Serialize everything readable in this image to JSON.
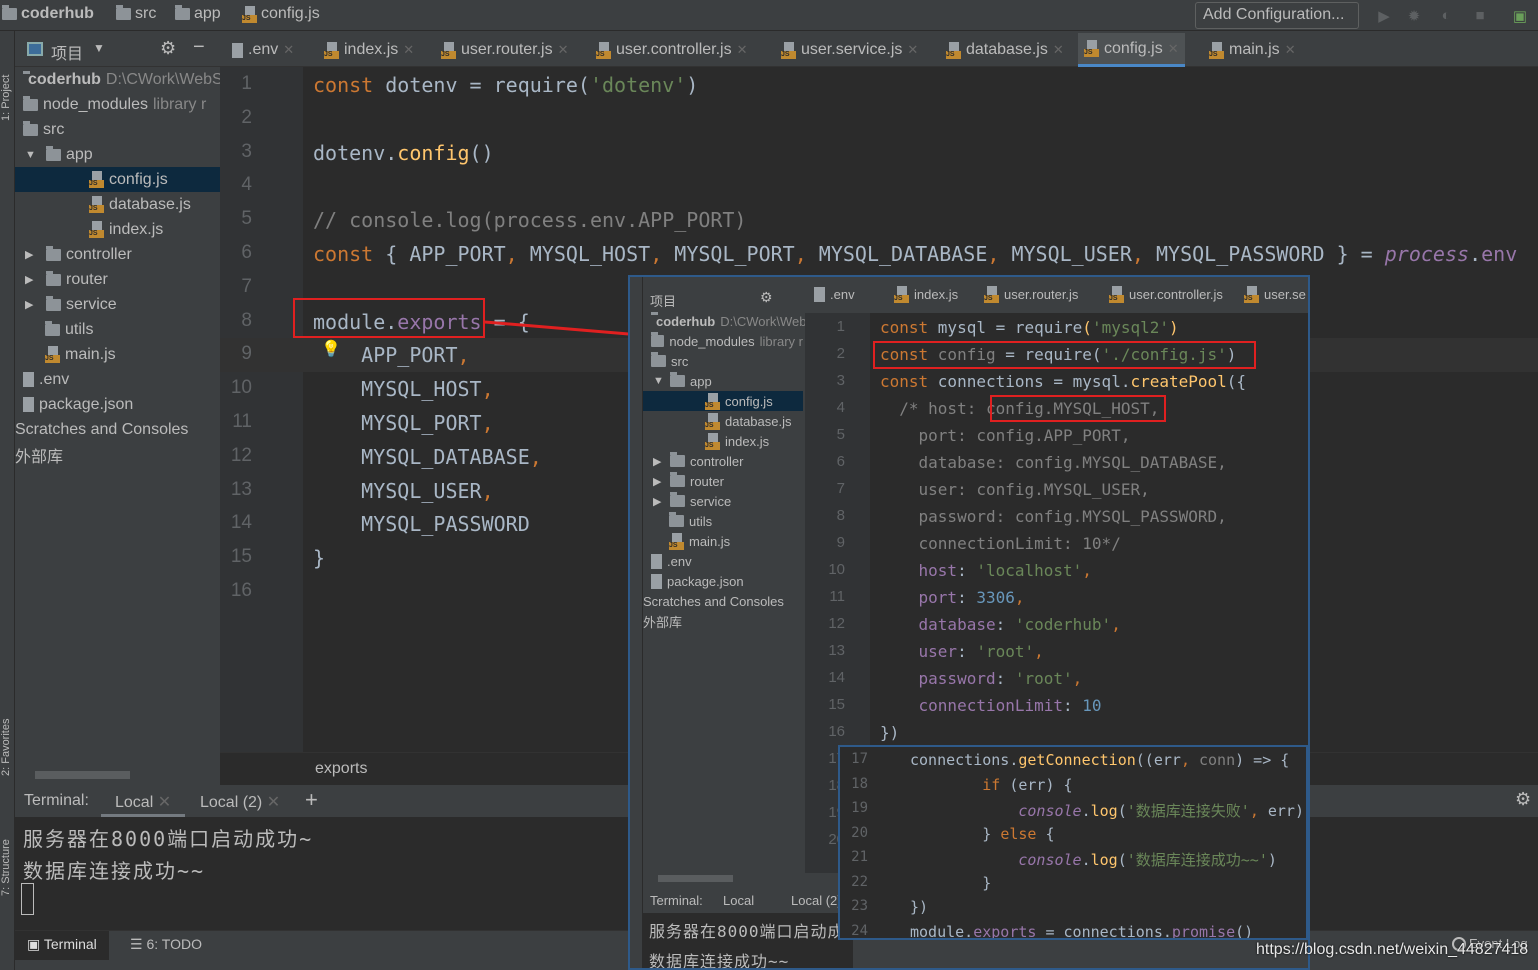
{
  "breadcrumb": [
    "coderhub",
    "src",
    "app",
    "config.js"
  ],
  "toolbar": {
    "add_configuration": "Add Configuration..."
  },
  "side_labels": {
    "project": "1: Project",
    "favorites": "2: Favorites",
    "structure": "7: Structure"
  },
  "project_panel": {
    "title": "项目"
  },
  "tabs": [
    ".env",
    "index.js",
    "user.router.js",
    "user.controller.js",
    "user.service.js",
    "database.js",
    "config.js",
    "main.js"
  ],
  "active_tab": "config.js",
  "tree": [
    {
      "label": "coderhub",
      "hint": "D:\\CWork\\WebS",
      "icon": "folder",
      "indent": 0,
      "bold": true
    },
    {
      "label": "node_modules",
      "hint": "library r",
      "icon": "folder",
      "indent": 0
    },
    {
      "label": "src",
      "icon": "folder",
      "indent": 0
    },
    {
      "label": "app",
      "icon": "folder",
      "indent": 1,
      "arrow": "▼"
    },
    {
      "label": "config.js",
      "icon": "js",
      "indent": 3,
      "selected": true
    },
    {
      "label": "database.js",
      "icon": "js",
      "indent": 3
    },
    {
      "label": "index.js",
      "icon": "js",
      "indent": 3
    },
    {
      "label": "controller",
      "icon": "folder",
      "indent": 1,
      "arrow": "▶"
    },
    {
      "label": "router",
      "icon": "folder",
      "indent": 1,
      "arrow": "▶"
    },
    {
      "label": "service",
      "icon": "folder",
      "indent": 1,
      "arrow": "▶"
    },
    {
      "label": "utils",
      "icon": "folder",
      "indent": 1
    },
    {
      "label": "main.js",
      "icon": "js",
      "indent": 1
    },
    {
      "label": ".env",
      "icon": "file",
      "indent": 0
    },
    {
      "label": "package.json",
      "icon": "file",
      "indent": 0
    },
    {
      "label": "Scratches and Consoles",
      "icon": "none",
      "indent": -1
    },
    {
      "label": "外部库",
      "icon": "none",
      "indent": -1
    }
  ],
  "editor": {
    "current_line": 9,
    "lines": [
      [
        [
          "const ",
          "kw"
        ],
        [
          "dotenv",
          "plain"
        ],
        [
          " = ",
          "plain"
        ],
        [
          "require",
          "plain"
        ],
        [
          "(",
          "plain"
        ],
        [
          "'dotenv'",
          "str"
        ],
        [
          ")",
          "plain"
        ]
      ],
      [],
      [
        [
          "dotenv.",
          "plain"
        ],
        [
          "config",
          "fn"
        ],
        [
          "()",
          "plain"
        ]
      ],
      [],
      [
        [
          "// console.log(process.env.APP_PORT)",
          "cm"
        ]
      ],
      [
        [
          "const ",
          "kw"
        ],
        [
          "{ APP_PORT",
          "plain"
        ],
        [
          ", ",
          "kw"
        ],
        [
          "MYSQL_HOST",
          "plain"
        ],
        [
          ", ",
          "kw"
        ],
        [
          "MYSQL_PORT",
          "plain"
        ],
        [
          ", ",
          "kw"
        ],
        [
          "MYSQL_DATABASE",
          "plain"
        ],
        [
          ", ",
          "kw"
        ],
        [
          "MYSQL_USER",
          "plain"
        ],
        [
          ", ",
          "kw"
        ],
        [
          "MYSQL_PASSWORD } = ",
          "plain"
        ],
        [
          "process",
          "it"
        ],
        [
          ".",
          "plain"
        ],
        [
          "env",
          "prop"
        ]
      ],
      [],
      [
        [
          "module.",
          "plain"
        ],
        [
          "exports",
          "prop"
        ],
        [
          " = {",
          "plain"
        ]
      ],
      [
        [
          "    APP_PORT",
          "plain"
        ],
        [
          ",",
          "kw"
        ]
      ],
      [
        [
          "    MYSQL_HOST",
          "plain"
        ],
        [
          ",",
          "kw"
        ]
      ],
      [
        [
          "    MYSQL_PORT",
          "plain"
        ],
        [
          ",",
          "kw"
        ]
      ],
      [
        [
          "    MYSQL_DATABASE",
          "plain"
        ],
        [
          ",",
          "kw"
        ]
      ],
      [
        [
          "    MYSQL_USER",
          "plain"
        ],
        [
          ",",
          "kw"
        ]
      ],
      [
        [
          "    MYSQL_PASSWORD",
          "plain"
        ]
      ],
      [
        [
          "}",
          "plain"
        ]
      ],
      []
    ],
    "breadcrumb": "exports"
  },
  "terminal": {
    "label": "Terminal:",
    "tabs": [
      "Local",
      "Local (2)"
    ],
    "output": [
      "服务器在8000端口启动成功~",
      "数据库连接成功~~"
    ]
  },
  "bottom_tabs": [
    "Terminal",
    "6: TODO"
  ],
  "inner_screenshot": {
    "tabs": [
      ".env",
      "index.js",
      "user.router.js",
      "user.controller.js",
      "user.se"
    ],
    "lines": [
      [
        [
          "const ",
          "kw"
        ],
        [
          "mysql = require",
          "plain"
        ],
        [
          "(",
          "fn"
        ],
        [
          "'mysql2'",
          "str"
        ],
        [
          ")",
          "fn"
        ]
      ],
      [
        [
          "const ",
          "kw"
        ],
        [
          "config",
          "cm"
        ],
        [
          " = require(",
          "plain"
        ],
        [
          "'./config.js'",
          "str"
        ],
        [
          ")",
          "plain"
        ]
      ],
      [
        [
          "const ",
          "kw"
        ],
        [
          "connections = mysql.",
          "plain"
        ],
        [
          "createPool",
          "fn"
        ],
        [
          "({",
          "plain"
        ]
      ],
      [
        [
          "  /* host: config.MYSQL_HOST,",
          "cm"
        ]
      ],
      [
        [
          "    port: config.APP_PORT,",
          "cm"
        ]
      ],
      [
        [
          "    database: config.MYSQL_DATABASE,",
          "cm"
        ]
      ],
      [
        [
          "    user: config.MYSQL_USER,",
          "cm"
        ]
      ],
      [
        [
          "    password: config.MYSQL_PASSWORD,",
          "cm"
        ]
      ],
      [
        [
          "    connectionLimit: 10*/",
          "cm"
        ]
      ],
      [
        [
          "    host",
          "prop"
        ],
        [
          ": ",
          "plain"
        ],
        [
          "'localhost'",
          "str"
        ],
        [
          ",",
          "kw"
        ]
      ],
      [
        [
          "    port",
          "prop"
        ],
        [
          ": ",
          "plain"
        ],
        [
          "3306",
          "num"
        ],
        [
          ",",
          "kw"
        ]
      ],
      [
        [
          "    database",
          "prop"
        ],
        [
          ": ",
          "plain"
        ],
        [
          "'coderhub'",
          "str"
        ],
        [
          ",",
          "kw"
        ]
      ],
      [
        [
          "    user",
          "prop"
        ],
        [
          ": ",
          "plain"
        ],
        [
          "'root'",
          "str"
        ],
        [
          ",",
          "kw"
        ]
      ],
      [
        [
          "    password",
          "prop"
        ],
        [
          ": ",
          "plain"
        ],
        [
          "'root'",
          "str"
        ],
        [
          ",",
          "kw"
        ]
      ],
      [
        [
          "    connectionLimit",
          "prop"
        ],
        [
          ": ",
          "plain"
        ],
        [
          "10",
          "num"
        ]
      ],
      [
        [
          "})",
          "plain"
        ]
      ]
    ],
    "lines2": [
      [
        [
          "connections.",
          "plain"
        ],
        [
          "getConnection",
          "fn"
        ],
        [
          "((err",
          "plain"
        ],
        [
          ", ",
          "kw"
        ],
        [
          "conn",
          "cm"
        ],
        [
          ") => {",
          "plain"
        ]
      ],
      [
        [
          "        if ",
          "kw"
        ],
        [
          "(err) {",
          "plain"
        ]
      ],
      [
        [
          "            console",
          "it"
        ],
        [
          ".",
          "plain"
        ],
        [
          "log",
          "fn"
        ],
        [
          "(",
          "plain"
        ],
        [
          "'数据库连接失败'",
          "str"
        ],
        [
          ", ",
          "kw"
        ],
        [
          "err)",
          "plain"
        ]
      ],
      [
        [
          "        } ",
          "plain"
        ],
        [
          "else ",
          "kw"
        ],
        [
          "{",
          "plain"
        ]
      ],
      [
        [
          "            console",
          "it"
        ],
        [
          ".",
          "plain"
        ],
        [
          "log",
          "fn"
        ],
        [
          "(",
          "plain"
        ],
        [
          "'数据库连接成功~~'",
          "str"
        ],
        [
          ")",
          "plain"
        ]
      ],
      [
        [
          "        }",
          "plain"
        ]
      ],
      [
        [
          "})",
          "plain"
        ]
      ],
      [
        [
          "module.",
          "plain"
        ],
        [
          "exports",
          "prop"
        ],
        [
          " = connections.",
          "plain"
        ],
        [
          "promise",
          "prop"
        ],
        [
          "()",
          "plain"
        ]
      ]
    ],
    "terminal_label": "Terminal:",
    "terminal_tabs": [
      "Local",
      "Local (2)"
    ],
    "terminal_output": [
      "服务器在8000端口启动成",
      "数据库连接成功~~"
    ]
  },
  "watermark": "https://blog.csdn.net/weixin_44827418",
  "event_log": "Event Log"
}
